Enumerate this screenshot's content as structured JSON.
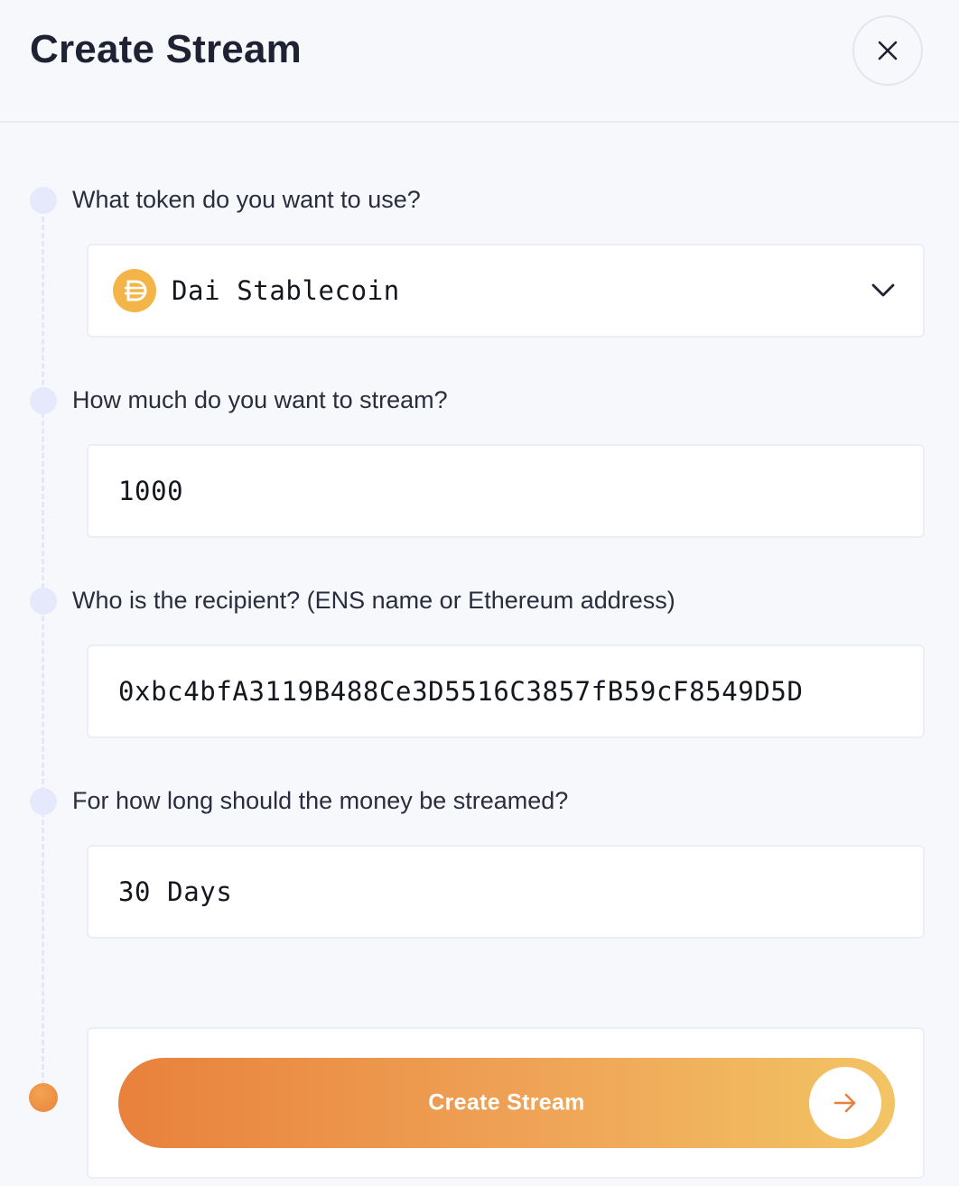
{
  "header": {
    "title": "Create Stream"
  },
  "steps": [
    {
      "label": "What token do you want to use?"
    },
    {
      "label": "How much do you want to stream?"
    },
    {
      "label": "Who is the recipient? (ENS name or Ethereum address)"
    },
    {
      "label": "For how long should the money be streamed?"
    }
  ],
  "token": {
    "name": "Dai Stablecoin",
    "icon": "dai-icon"
  },
  "amount": {
    "value": "1000"
  },
  "recipient": {
    "value": "0xbc4bfA3119B488Ce3D5516C3857fB59cF8549D5D"
  },
  "duration": {
    "value": "30 Days"
  },
  "submit": {
    "label": "Create Stream"
  },
  "colors": {
    "accent_start": "#e8813c",
    "accent_end": "#f2c463",
    "token_icon": "#f3b548"
  }
}
